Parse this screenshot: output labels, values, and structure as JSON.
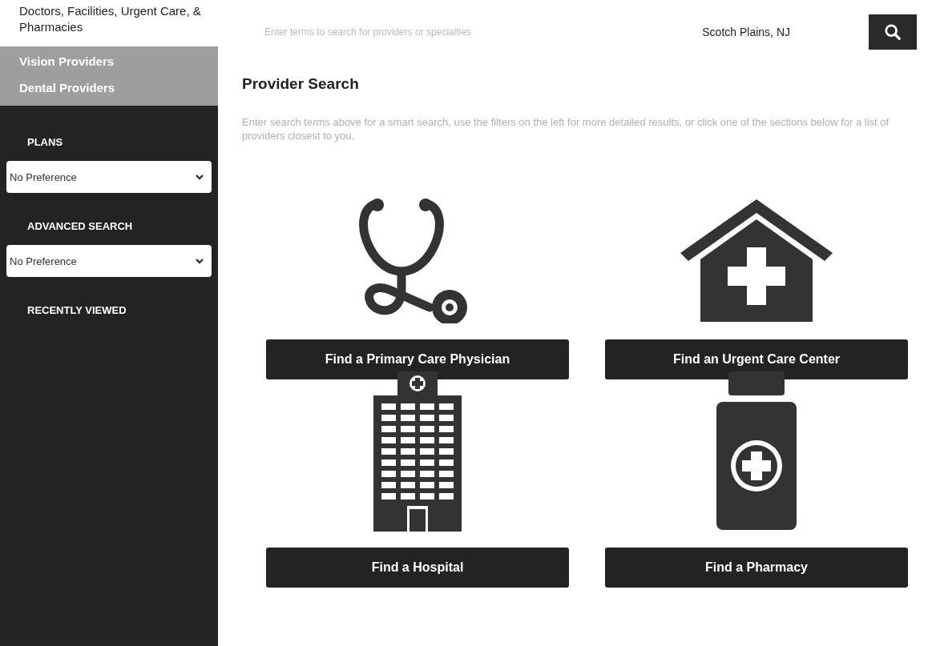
{
  "sidebar": {
    "heading": "Doctors, Facilities, Urgent Care, & Pharmacies",
    "links": [
      {
        "label": "Vision Providers"
      },
      {
        "label": "Dental Providers"
      }
    ],
    "filters": [
      {
        "label": "PLANS",
        "value": "No Preference"
      },
      {
        "label": "ADVANCED SEARCH",
        "value": "No Preference"
      }
    ],
    "recent_label": "RECENTLY VIEWED"
  },
  "search": {
    "placeholder": "Enter terms to search for providers or specialties",
    "location": "Scotch Plains, NJ"
  },
  "main": {
    "title": "Provider Search",
    "description": "Enter search terms above for a smart search, use the filters on the left for more detailed results, or click one of the sections below for a list of providers closest to you.",
    "cards": [
      {
        "kind": "physician",
        "label": "Find a Primary Care Physician"
      },
      {
        "kind": "urgent",
        "label": "Find an Urgent Care Center"
      },
      {
        "kind": "hospital",
        "label": "Find a Hospital"
      },
      {
        "kind": "pharmacy",
        "label": "Find a Pharmacy"
      }
    ]
  }
}
